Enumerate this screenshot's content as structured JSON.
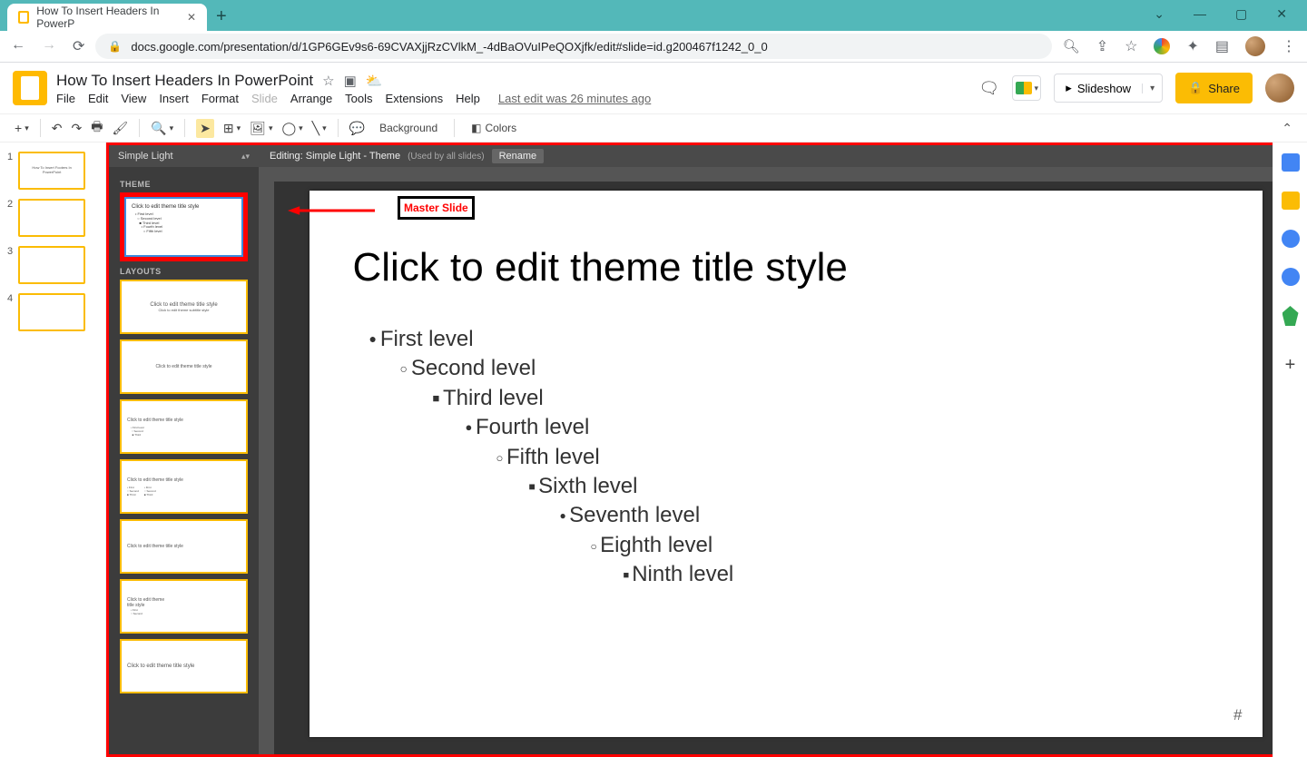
{
  "browser": {
    "tab_title": "How To Insert Headers In PowerP",
    "url": "docs.google.com/presentation/d/1GP6GEv9s6-69CVAXjjRzCVlkM_-4dBaOVuIPeQOXjfk/edit#slide=id.g200467f1242_0_0"
  },
  "app": {
    "doc_title": "How To Insert Headers In PowerPoint",
    "last_edit": "Last edit was 26 minutes ago",
    "menus": [
      "File",
      "Edit",
      "View",
      "Insert",
      "Format",
      "Slide",
      "Arrange",
      "Tools",
      "Extensions",
      "Help"
    ],
    "disabled_menu": "Slide",
    "slideshow_label": "Slideshow",
    "share_label": "Share"
  },
  "toolbar": {
    "background": "Background",
    "colors": "Colors"
  },
  "theme_panel": {
    "header": "Simple Light",
    "theme_label": "THEME",
    "layouts_label": "LAYOUTS",
    "master_text": "Click to edit theme title style",
    "layouts": [
      "Click to edit theme title style",
      "Click to edit theme title style",
      "Click to edit theme title style",
      "Click to edit theme title style",
      "Click to edit theme title style",
      "Click to edit theme title style",
      "Click to edit theme title style"
    ]
  },
  "edit_bar": {
    "prefix": "Editing: Simple Light - Theme",
    "used": "(Used by all slides)",
    "rename": "Rename"
  },
  "slide": {
    "title": "Click to edit theme title style",
    "levels": [
      "First level",
      "Second level",
      "Third level",
      "Fourth level",
      "Fifth level",
      "Sixth level",
      "Seventh level",
      "Eighth level",
      "Ninth level"
    ],
    "page_num": "#"
  },
  "page_thumbs": {
    "thumb1_title": "How To Insert Footers In PowerPoint",
    "nums": [
      "1",
      "2",
      "3",
      "4"
    ]
  },
  "annotation": {
    "label": "Master Slide"
  }
}
